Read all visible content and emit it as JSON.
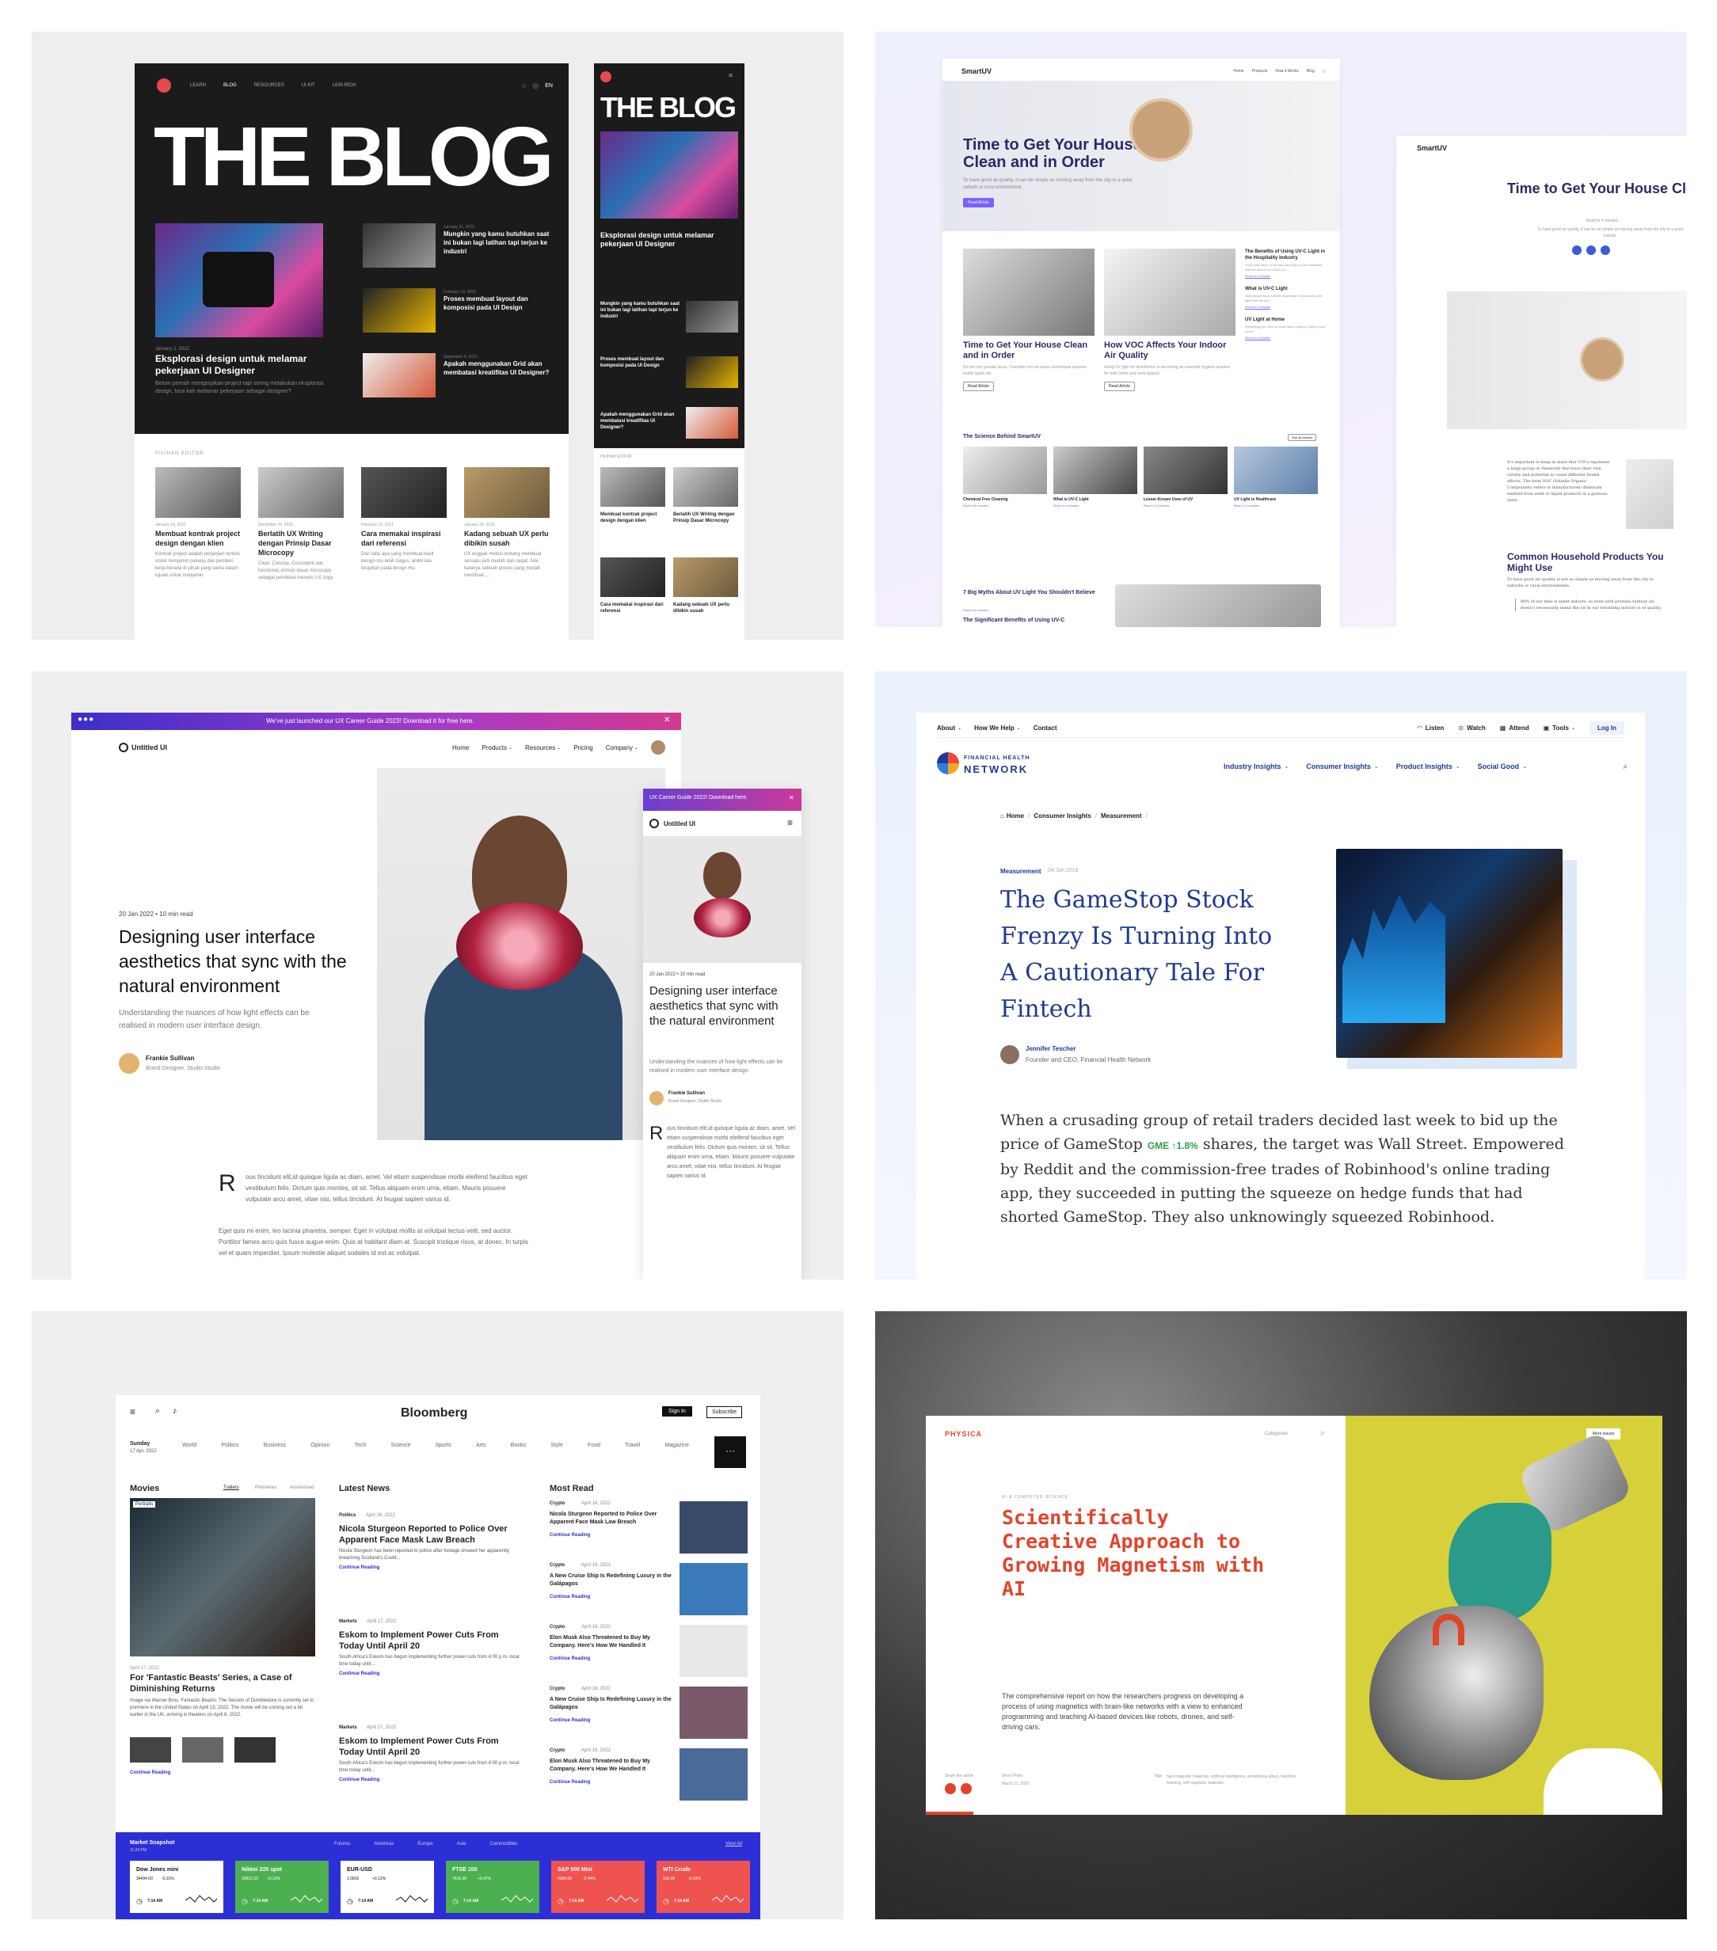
{
  "blog": {
    "nav": [
      "LEARN",
      "BLOG",
      "RESOURCES",
      "UI KIT",
      "LEIN RICH"
    ],
    "lang": "EN",
    "title": "THE BLOG",
    "hero_date": "January 2, 2022",
    "hero_title": "Eksplorasi design untuk melamar pekerjaan UI Designer",
    "hero_desc": "Belum pernah mengerjakan project tapi sering melakukan eksplorasi design, bisa kah melamar pekerjaan sebagai designer?",
    "side": [
      {
        "date": "January 31, 2022",
        "title": "Mungkin yang kamu butuhkan saat ini bukan lagi latihan tapi terjun ke industri"
      },
      {
        "date": "February 14, 2022",
        "title": "Proses membuat layout dan komposisi pada UI Design"
      },
      {
        "date": "September 4, 2021",
        "title": "Apakah menggunakan Grid akan membatasi kreatifitas UI Designer?"
      }
    ],
    "picks_label": "PILIHAN EDITOR",
    "picks": [
      {
        "date": "January 14, 2022",
        "title": "Membuat kontrak project design dengan klien",
        "desc": "Kontrak project adalah perjanjian tertulis untuk menjamin pekerja dan pemberi kerja berada di pihak yang sama dalam tujuan untuk menjamin"
      },
      {
        "date": "December 24, 2021",
        "title": "Berlatih UX Writing dengan Prinsip Dasar Microcopy",
        "desc": "Clear, Concise, Consistent dan functional, prinsip dasar microcopy sebagai pendekat menulis UX copy"
      },
      {
        "date": "February 15, 2021",
        "title": "Cara memakai inspirasi dari referensi",
        "desc": "Dan tahu apa yang membuat hasil design-mu lebih bagus, ambil lalu terapkan pada design mu"
      },
      {
        "date": "January 24, 2022",
        "title": "Kadang sebuah UX perlu dibikin susah",
        "desc": "UX enggak melulu tentang membuat sesuatu jadi mudah dan cepat. Ada kalanya sebuah proses yang mudah membuat ..."
      }
    ],
    "mobile_side": [
      "Mungkin yang kamu butuhkan saat ini bukan lagi latihan tapi terjun ke industri",
      "Proses membuat layout dan komposisi pada UI Design",
      "Apakah menggunakan Grid akan membatasi kreatifitas UI Designer?"
    ],
    "mobile_picks_label": "PILIHAN EDITOR",
    "mobile_picks": [
      "Membuat kontrak project design dengan klien",
      "Berlatih UX Writing dengan Prinsip Dasar Microcopy",
      "Cara memakai inspirasi dari referensi",
      "Kadang sebuah UX perlu dibikin susah"
    ]
  },
  "smartuv": {
    "logo": "SmartUV",
    "nav": [
      "Home",
      "Products",
      "How it Works",
      "Blog"
    ],
    "hero_title": "Time to Get Your House Clean and in Order",
    "hero_desc": "To have good air quality, it can be simple as moving away from the city to a quiet suburb or rural environment.",
    "hero_btn": "Read Article",
    "cards": [
      {
        "title": "Time to Get Your House Clean and in Order",
        "desc": "Do not non gravida lacus. Convallis non vel purus scelerisque posuere mattis quam vel.",
        "btn": "Read Article"
      },
      {
        "title": "How VOC Affects Your Indoor Air Quality",
        "desc": "Using UV light for disinfection is becoming an essential hygiene practice for both home and work spaces.",
        "btn": "Read Article"
      }
    ],
    "side_list": [
      {
        "title": "The Benefits of Using UV-C Light in the Hospitality Industry",
        "desc": "Travel has taken on all new meaning in post-restaurant with the advent of COVID-19.",
        "link": "Read in 4 minutes"
      },
      {
        "title": "What is UV-C Light",
        "desc": "Most people have a basic knowledge of ultraviolet (UV) light from the sun.",
        "link": "Read in 4 minutes"
      },
      {
        "title": "UV Light at Home",
        "desc": "Everything you need to know about using UV light in your home.",
        "link": "Read in 5 minutes"
      }
    ],
    "science_label": "The Science Behind SmartUV",
    "science_btn": "See all Articles",
    "science": [
      {
        "title": "Chemical Free Cleaning",
        "link": "Read in 6 minutes"
      },
      {
        "title": "What is UV-C Light",
        "link": "Read in 4 minutes"
      },
      {
        "title": "Lesser-Known Uses of UV",
        "link": "Read in 4 minutes"
      },
      {
        "title": "UV Light in Healthcare",
        "link": "Read in 4 minutes"
      }
    ],
    "myths_title": "7 Big Myths About UV Light You Shouldn't Believe",
    "myths_link": "Read in 6 minutes",
    "benefits_title": "The Significant Benefits of Using UV-C",
    "m_logo": "SmartUV",
    "m_title": "Time to Get Your House Clean and in Order",
    "m_read": "Read in 4 minutes",
    "m_desc": "To have good air quality, it can be as simple as moving away from the city to a quiet suburb.",
    "m_body": "It's important to keep in mind that VOCs represent a large group of chemicals that have their own variety and potential to cause different health effects. The term VOC (Volatile Organic Compounds) refers to manufactured chemicals emitted from solid or liquid products in a gaseous state.",
    "m_sub": "Common Household Products You Might Use",
    "m_sub_desc": "To have good air quality is not as simple as moving away from the city to suburbs or rural environments.",
    "m_quote": "90% of our time is spent indoors, so even with pristine outdoor air, doesn't necessarily mean the air in our breathing indoors is of quality."
  },
  "untitled": {
    "banner": "We've just launched our UX Career Guide 2023! Download it for free here.",
    "logo": "Untitled UI",
    "nav": [
      "Home",
      "Products",
      "Resources",
      "Pricing",
      "Company"
    ],
    "meta": "20 Jan 2022 • 10 min read",
    "title": "Designing user interface aesthetics that sync with the natural environment",
    "desc": "Understanding the nuances of how light effects can be realised in modern user interface design.",
    "author": "Frankie Sullivan",
    "role": "Brand Designer, Studio Studio",
    "p1": "ous tincidunt elit,id quisque ligula ac diam, amet. Vel etiam suspendisse morbi eleifend faucibus eget vestibulum felis. Dictum quis montes, sit sit. Tellus aliquam enim urna, etiam. Mauris posuere vulputate arcu amet, vitae nisi, tellus tincidunt. At feugiat sapien varius id.",
    "p2": "Eget quis mi enim, leo lacinia pharetra, semper. Eget in volutpat mollis at volutpat lectus velit, sed auctor. Porttitor fames arcu quis fusce augue enim. Quis at habitant diam at. Suscipit tristique risus, at donec. In turpis vel et quam imperdiet. Ipsum molestie aliquet sodales id est ac volutpat.",
    "m_banner": "UX Career Guide 2022! Download here.",
    "m_logo": "Untitled UI",
    "m_meta": "20 Jan 2022 • 10 min read",
    "m_title": "Designing user interface aesthetics that sync with the natural environment",
    "m_desc": "Understanding the nuances of how light effects can be realised in modern user interface design.",
    "m_author": "Frankie Sullivan",
    "m_role": "Brand Designer, Studio Studio",
    "m_p1": "ous tincidunt elit,id quisque ligula ac diam, amet. Vel etiam suspendisse morbi eleifend faucibus eget vestibulum felis. Dictum quis montes, sit sit. Tellus aliquam enim urna, etiam. Mauris posuere vulputate arcu amet, vitae nisi, tellus tincidunt. At feugiat sapien varius id."
  },
  "fhn": {
    "topnav": [
      "About",
      "How We Help",
      "Contact"
    ],
    "topright": [
      "Listen",
      "Watch",
      "Attend",
      "Tools"
    ],
    "login": "Log In",
    "logo_top": "FINANCIAL HEALTH",
    "logo_bottom": "NETWORK",
    "mainnav": [
      "Industry Insights",
      "Consumer Insights",
      "Product Insights",
      "Social Good"
    ],
    "crumbs": [
      "Home",
      "Consumer Insights",
      "Measurement"
    ],
    "category": "Measurement",
    "date": "04 Jun 2018",
    "title": "The GameStop Stock Frenzy Is Turning Into A Cautionary Tale For Fintech",
    "author": "Jennifer Tescher",
    "role": "Founder and CEO, Financial Health Network",
    "body_a": "When a crusading group of retail traders decided last week to bid up the price of GameStop",
    "ticker": "GME ↑1.8%",
    "body_b": "shares, the target was Wall Street. Empowered by Reddit and the commission-free trades of Robinhood's online trading app, they succeeded in putting the squeeze on hedge funds that had shorted GameStop. They also unknowingly squeezed Robinhood."
  },
  "bloomberg": {
    "logo": "Bloomberg",
    "signin": "Sign In",
    "subscribe": "Subscribe",
    "day": "Sunday",
    "date": "17 Apr, 2022",
    "nav": [
      "World",
      "Politics",
      "Business",
      "Opinion",
      "Tech",
      "Science",
      "Sports",
      "Arts",
      "Books",
      "Style",
      "Food",
      "Travel",
      "Magazine"
    ],
    "movies": "Movies",
    "movie_tabs": [
      "Trailers",
      "Premieres",
      "Announced"
    ],
    "movie_tag": "Portraits",
    "movie_date": "April 17, 2022",
    "movie_title": "For 'Fantastic Beasts' Series, a Case of Diminishing Returns",
    "movie_desc": "Image via Warner Bros. Fantastic Beasts: The Secrets of Dumbledore is currently set to premiere in the United States on April 15, 2022. The movie will be coming out a bit earlier in the UK, arriving in theaters on April 8, 2022.",
    "continue": "Continue Reading",
    "latest": "Latest News",
    "latest_items": [
      {
        "tag": "Politics",
        "date": "April 16, 2022",
        "title": "Nicola Sturgeon Reported to Police Over Apparent Face Mask Law Breach",
        "desc": "Nicola Sturgeon has been reported to police after footage showed her apparently breaching Scotland's Covid..."
      },
      {
        "tag": "Markets",
        "date": "April 17, 2022",
        "title": "Eskom to Implement Power Cuts From Today Until April 20",
        "desc": "South Africa's Eskom has begun implementing further power cuts from 4:00 p.m. local time today until..."
      },
      {
        "tag": "Markets",
        "date": "April 17, 2022",
        "title": "Eskom to Implement Power Cuts From Today Until April 20",
        "desc": "South Africa's Eskom has begun implementing further power cuts from 4:00 p.m. local time today until..."
      }
    ],
    "most": "Most Read",
    "most_items": [
      {
        "tag": "Crypto",
        "date": "April 16, 2022",
        "title": "Nicola Sturgeon Reported to Police Over Apparent Face Mask Law Breach"
      },
      {
        "tag": "Crypto",
        "date": "April 16, 2022",
        "title": "A New Cruise Ship Is Redefining Luxury in the Galápagos"
      },
      {
        "tag": "Crypto",
        "date": "April 16, 2022",
        "title": "Elon Musk Also Threatened to Buy My Company. Here's How We Handled It"
      },
      {
        "tag": "Crypto",
        "date": "April 16, 2022",
        "title": "A New Cruise Ship Is Redefining Luxury in the Galápagos"
      },
      {
        "tag": "Crypto",
        "date": "April 16, 2022",
        "title": "Elon Musk Also Threatened to Buy My Company. Here's How We Handled It"
      }
    ],
    "market": "Market Snapshot",
    "market_time": "11:24 PM",
    "market_tabs": [
      "Futures",
      "Americas",
      "Europe",
      "Asia",
      "Commodities"
    ],
    "view_all": "View All",
    "tickers": [
      {
        "name": "Dow Jones mini",
        "val": "34494.00",
        "chg": "-0.31%",
        "color": "#ffffff",
        "fg": "#111"
      },
      {
        "name": "Nikkei 225 spot",
        "val": "26821.50",
        "chg": "+0.19%",
        "color": "#4caf50",
        "fg": "#fff"
      },
      {
        "name": "EUR-USD",
        "val": "1.0810",
        "chg": "+0.12%",
        "color": "#ffffff",
        "fg": "#111"
      },
      {
        "name": "FTSE 100",
        "val": "7616.38",
        "chg": "+0.47%",
        "color": "#4caf50",
        "fg": "#fff"
      },
      {
        "name": "S&P 500 Mini",
        "val": "4384.00",
        "chg": "-0.44%",
        "color": "#ef5350",
        "fg": "#fff"
      },
      {
        "name": "WTI Crude",
        "val": "106.95",
        "chg": "-0.31%",
        "color": "#ef5350",
        "fg": "#fff"
      }
    ],
    "ticker_time": "7:14 AM"
  },
  "physica": {
    "logo": "PHYSICA",
    "categories": "Categories",
    "more": "More Issues",
    "kicker": "AI & COMPUTER SCIENCE",
    "title": "Scientifically Creative Approach to Growing Magnetism with AI",
    "desc": "The comprehensive report on how the researchers progress on developing a process of using magnetics with brain-like networks with a view to enhanced programming and teaching AI-based devices like robots, drones, and self-driving cars.",
    "share": "Share the article",
    "short_label": "Short Photo",
    "short_date": "March 11, 2020",
    "tags_label": "Tags",
    "tags": "hard magnetic materials, artificial intelligence, amorphous alloys, machine learning, soft magnetic materials"
  },
  "colors": {
    "blog_bg": "#1b1b1b",
    "blog_accent": "#e5484d",
    "smartuv_purple": "#7b61ff",
    "untitled_purple": "#7f56d9",
    "fhn_blue": "#1f3a93",
    "bloom_blue": "#2d2fd6",
    "physica_red": "#e0452b",
    "physica_yellow": "#d6d13a"
  }
}
